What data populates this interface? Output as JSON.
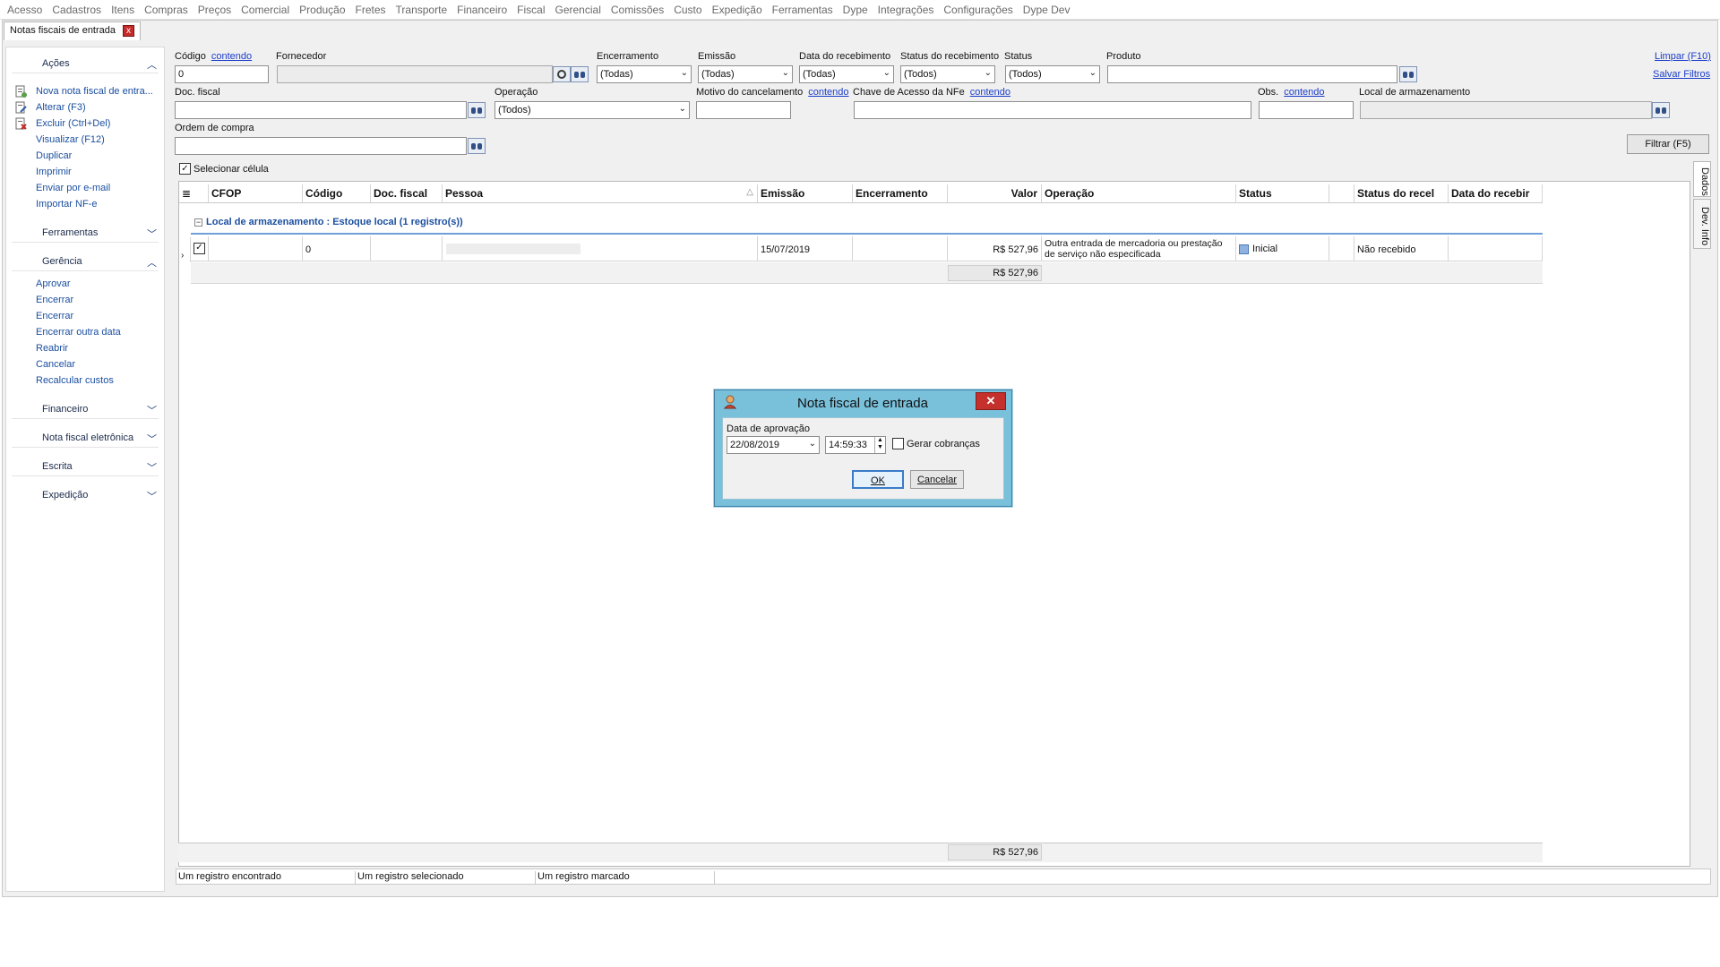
{
  "menu": [
    "Acesso",
    "Cadastros",
    "Itens",
    "Compras",
    "Preços",
    "Comercial",
    "Produção",
    "Fretes",
    "Transporte",
    "Financeiro",
    "Fiscal",
    "Gerencial",
    "Comissões",
    "Custo",
    "Expedição",
    "Ferramentas",
    "Dype",
    "Integrações",
    "Configurações",
    "Dype Dev"
  ],
  "tab": {
    "title": "Notas fiscais de entrada",
    "close": "x"
  },
  "sidebar": {
    "acoes": {
      "title": "Ações",
      "items": [
        "Nova nota fiscal de entra...",
        "Alterar (F3)",
        "Excluir (Ctrl+Del)",
        "Visualizar (F12)",
        "Duplicar",
        "Imprimir",
        "Enviar por e-mail",
        "Importar NF-e"
      ]
    },
    "ferramentas": {
      "title": "Ferramentas"
    },
    "gerencia": {
      "title": "Gerência",
      "items": [
        "Aprovar",
        "Encerrar",
        "Encerrar",
        "Encerrar outra data",
        "Reabrir",
        "Cancelar",
        "Recalcular custos"
      ]
    },
    "collapsed": [
      "Financeiro",
      "Nota fiscal eletrônica",
      "Escrita",
      "Expedição"
    ]
  },
  "filters": {
    "codigo": {
      "label": "Código",
      "link": "contendo",
      "value": "0"
    },
    "fornecedor": {
      "label": "Fornecedor",
      "value": ""
    },
    "encerramento": {
      "label": "Encerramento",
      "value": "(Todas)"
    },
    "emissao": {
      "label": "Emissão",
      "value": "(Todas)"
    },
    "data_recebimento": {
      "label": "Data do recebimento",
      "value": "(Todas)"
    },
    "status_recebimento": {
      "label": "Status do recebimento",
      "value": "(Todos)"
    },
    "status": {
      "label": "Status",
      "value": "(Todos)"
    },
    "produto": {
      "label": "Produto",
      "value": ""
    },
    "doc_fiscal": {
      "label": "Doc. fiscal",
      "value": ""
    },
    "operacao": {
      "label": "Operação",
      "value": "(Todos)"
    },
    "motivo_cancelamento": {
      "label": "Motivo do cancelamento",
      "link": "contendo",
      "value": ""
    },
    "chave_nfe": {
      "label": "Chave de Acesso da NFe",
      "link": "contendo",
      "value": ""
    },
    "obs": {
      "label": "Obs.",
      "link": "contendo",
      "value": ""
    },
    "local_armazenamento": {
      "label": "Local de armazenamento",
      "value": ""
    },
    "ordem_compra": {
      "label": "Ordem de compra",
      "value": ""
    },
    "limpar": "Limpar (F10)",
    "salvar": "Salvar Filtros",
    "filtrar": "Filtrar (F5)"
  },
  "grid": {
    "select_cell_label": "Selecionar célula",
    "select_cell_checked": true,
    "columns": [
      "CFOP",
      "Código",
      "Doc. fiscal",
      "Pessoa",
      "Emissão",
      "Encerramento",
      "Valor",
      "Operação",
      "Status",
      "Status do recel",
      "Data do recebir"
    ],
    "group_label": "Local de armazenamento : Estoque local (1 registro(s))",
    "rows": [
      {
        "checked": true,
        "cfop": "",
        "codigo": "0",
        "doc_fiscal": "",
        "pessoa": "",
        "emissao": "15/07/2019",
        "encerramento": "",
        "valor": "R$ 527,96",
        "operacao": "Outra entrada de mercadoria ou prestação de serviço não especificada",
        "status": "Inicial",
        "status_recebimento": "Não recebido",
        "data_recebimento": ""
      }
    ],
    "group_total": "R$ 527,96",
    "footer_total": "R$ 527,96"
  },
  "side_tabs": [
    "Dados",
    "Dev. Info"
  ],
  "statusbar": [
    "Um registro encontrado",
    "Um registro selecionado",
    "Um registro marcado"
  ],
  "dialog": {
    "title": "Nota fiscal de entrada",
    "close": "✕",
    "date_label": "Data de aprovação",
    "date_value": "22/08/2019",
    "time_value": "14:59:33",
    "gerar_label": "Gerar cobranças",
    "gerar_checked": false,
    "ok": "OK",
    "cancel": "Cancelar"
  },
  "colors": {
    "link": "#1a3cc9",
    "sidebar_link": "#1b4fa0",
    "group_text": "#1b4fa0",
    "dialog_frame": "#79c0db",
    "close_red": "#c4302b"
  }
}
